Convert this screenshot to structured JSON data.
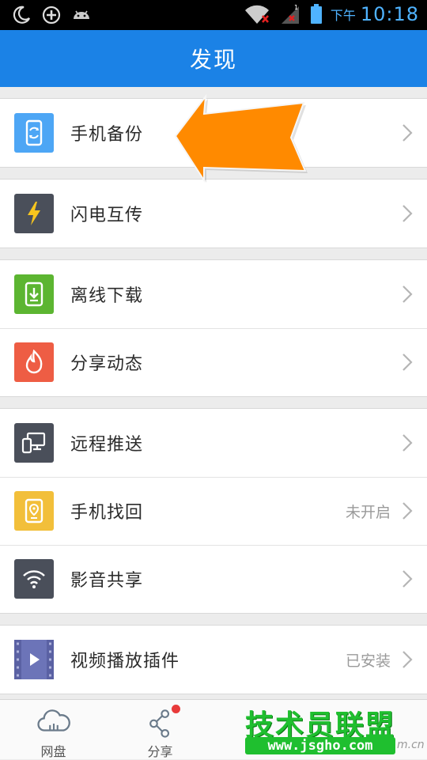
{
  "status_bar": {
    "ampm": "下午",
    "time": "10:18",
    "signal_badge": "1",
    "icons": [
      "moon-icon",
      "add-circle-icon",
      "android-icon",
      "wifi-icon",
      "signal-icon",
      "battery-icon"
    ]
  },
  "header": {
    "title": "发现"
  },
  "groups": [
    {
      "items": [
        {
          "label": "手机备份",
          "status": ""
        }
      ]
    },
    {
      "items": [
        {
          "label": "闪电互传",
          "status": ""
        }
      ]
    },
    {
      "items": [
        {
          "label": "离线下载",
          "status": ""
        },
        {
          "label": "分享动态",
          "status": ""
        }
      ]
    },
    {
      "items": [
        {
          "label": "远程推送",
          "status": ""
        },
        {
          "label": "手机找回",
          "status": "未开启"
        },
        {
          "label": "影音共享",
          "status": ""
        }
      ]
    },
    {
      "items": [
        {
          "label": "视频播放插件",
          "status": "已安装"
        }
      ]
    }
  ],
  "tab_bar": {
    "tabs": [
      {
        "label": "网盘",
        "icon": "cloud-icon"
      },
      {
        "label": "分享",
        "icon": "share-icon",
        "badge": true
      }
    ]
  },
  "watermark": {
    "title": "技术员联盟",
    "url": "www.jsgho.com",
    "suffix": "m.cn"
  },
  "colors": {
    "header": "#1b82e6",
    "backup_icon": "#4da6f5",
    "flash_icon": "#4a4f5a",
    "download_icon": "#5cb531",
    "feed_icon": "#ee5d44",
    "push_icon": "#4a4f5a",
    "find_icon": "#f2bf3a",
    "media_icon": "#4a4f5a",
    "video_icon": "#6c74b8",
    "arrow": "#ff8a00",
    "watermark": "#1fbf2f"
  }
}
